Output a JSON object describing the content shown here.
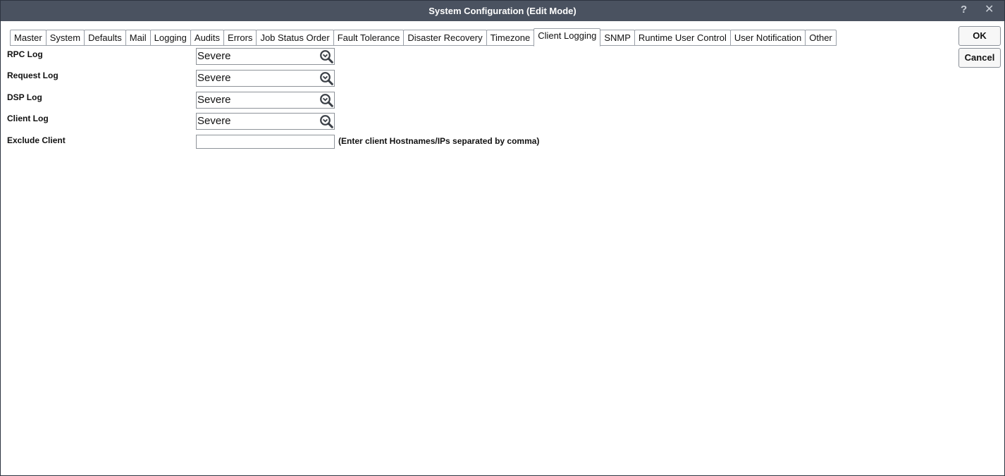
{
  "window": {
    "title": "System Configuration (Edit Mode)",
    "help_glyph": "?",
    "close_glyph": "✕"
  },
  "tabs": [
    {
      "label": "Master"
    },
    {
      "label": "System"
    },
    {
      "label": "Defaults"
    },
    {
      "label": "Mail"
    },
    {
      "label": "Logging"
    },
    {
      "label": "Audits"
    },
    {
      "label": "Errors"
    },
    {
      "label": "Job Status Order"
    },
    {
      "label": "Fault Tolerance"
    },
    {
      "label": "Disaster Recovery"
    },
    {
      "label": "Timezone"
    },
    {
      "label": "Client Logging",
      "active": true
    },
    {
      "label": "SNMP"
    },
    {
      "label": "Runtime User Control"
    },
    {
      "label": "User Notification"
    },
    {
      "label": "Other"
    }
  ],
  "buttons": {
    "ok_label": "OK",
    "cancel_label": "Cancel"
  },
  "form": {
    "rpc_log": {
      "label": "RPC Log",
      "value": "Severe"
    },
    "request_log": {
      "label": "Request Log",
      "value": "Severe"
    },
    "dsp_log": {
      "label": "DSP Log",
      "value": "Severe"
    },
    "client_log": {
      "label": "Client Log",
      "value": "Severe"
    },
    "exclude_client": {
      "label": "Exclude Client",
      "value": "",
      "hint": "(Enter client Hostnames/IPs separated by comma)"
    }
  },
  "icons": {
    "lookup": "magnifier-chevron-icon",
    "help": "question-icon",
    "close": "close-icon"
  },
  "colors": {
    "titlebar": "#4a5260",
    "border": "#8e9399"
  }
}
